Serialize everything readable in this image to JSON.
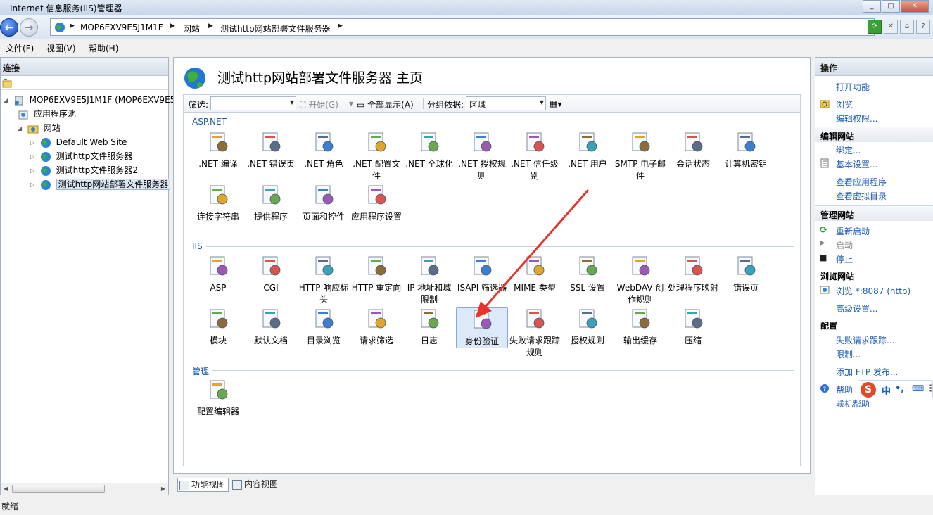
{
  "window": {
    "title": "Internet 信息服务(IIS)管理器"
  },
  "address": {
    "crumbs": [
      "MOP6EXV9E5J1M1F",
      "网站",
      "测试http网站部署文件服务器"
    ]
  },
  "menu": {
    "file": "文件(F)",
    "view": "视图(V)",
    "help": "帮助(H)"
  },
  "connections": {
    "header": "连接",
    "tree": {
      "server": "MOP6EXV9E5J1M1F (MOP6EXV9E5",
      "app_pools": "应用程序池",
      "sites": "网站",
      "site1": "Default Web Site",
      "site2": "测试http文件服务器",
      "site3": "测试http文件服务器2",
      "site4": "测试http网站部署文件服务器"
    }
  },
  "main": {
    "title": "测试http网站部署文件服务器 主页",
    "filter": {
      "label": "筛选:",
      "go": "开始(G)",
      "show_all": "全部显示(A)",
      "group_by": "分组依据:",
      "group_value": "区域"
    },
    "groups": {
      "aspnet": "ASP.NET",
      "iis": "IIS",
      "management": "管理"
    },
    "aspnet": [
      ".NET 编译",
      ".NET 错误页",
      ".NET 角色",
      ".NET 配置文件",
      ".NET 全球化",
      ".NET 授权规则",
      ".NET 信任级别",
      ".NET 用户",
      "SMTP 电子邮件",
      "会话状态",
      "计算机密钥",
      "连接字符串",
      "提供程序",
      "页面和控件",
      "应用程序设置"
    ],
    "iis": [
      "ASP",
      "CGI",
      "HTTP 响应标头",
      "HTTP 重定向",
      "IP 地址和域限制",
      "ISAPI 筛选器",
      "MIME 类型",
      "SSL 设置",
      "WebDAV 创作规则",
      "处理程序映射",
      "错误页",
      "模块",
      "默认文档",
      "目录浏览",
      "请求筛选",
      "日志",
      "身份验证",
      "失败请求跟踪规则",
      "授权规则",
      "输出缓存",
      "压缩"
    ],
    "management": [
      "配置编辑器"
    ],
    "view_tabs": {
      "features": "功能视图",
      "content": "内容视图"
    }
  },
  "actions": {
    "header": "操作",
    "open_feature": "打开功能",
    "browse": "浏览",
    "edit_perms": "编辑权限...",
    "edit_site": "编辑网站",
    "bindings": "绑定...",
    "basic_settings": "基本设置...",
    "view_apps": "查看应用程序",
    "view_vdirs": "查看虚拟目录",
    "manage_site": "管理网站",
    "restart": "重新启动",
    "start": "启动",
    "stop": "停止",
    "browse_site": "浏览网站",
    "browse_port": "浏览 *:8087 (http)",
    "advanced": "高级设置...",
    "config": "配置",
    "failed_req": "失败请求跟踪...",
    "limits": "限制...",
    "add_ftp": "添加 FTP 发布...",
    "help": "帮助",
    "online_help": "联机帮助"
  },
  "ime": {
    "logo": "S",
    "lang": "中",
    "punct": "•,"
  },
  "status": {
    "text": "就绪"
  },
  "colors": {
    "link": "#1f5db4",
    "group_header": "#1c5aa3",
    "annotation_arrow": "#e8322c"
  }
}
